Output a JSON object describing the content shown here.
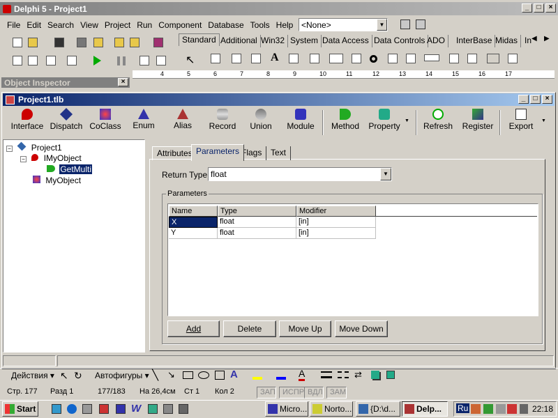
{
  "delphi": {
    "title": "Delphi 5 - Project1",
    "menu": [
      "File",
      "Edit",
      "Search",
      "View",
      "Project",
      "Run",
      "Component",
      "Database",
      "Tools",
      "Help"
    ],
    "config_combo": "<None>",
    "palette_tabs": [
      "Standard",
      "Additional",
      "Win32",
      "System",
      "Data Access",
      "Data Controls",
      "ADO",
      "InterBase",
      "Midas",
      "In"
    ],
    "ruler": [
      "4",
      "5",
      "6",
      "7",
      "8",
      "9",
      "10",
      "11",
      "12",
      "13",
      "14",
      "15",
      "16",
      "17"
    ]
  },
  "inspector": {
    "title": "Object Inspector"
  },
  "tlb": {
    "title": "Project1.tlb",
    "toolbar": [
      "Interface",
      "Dispatch",
      "CoClass",
      "Enum",
      "Alias",
      "Record",
      "Union",
      "Module",
      "Method",
      "Property",
      "Refresh",
      "Register",
      "Export"
    ],
    "tree": {
      "root": "Project1",
      "interface": "IMyObject",
      "method": "GetMulti",
      "coclass": "MyObject"
    },
    "tabs": [
      "Attributes",
      "Parameters",
      "Flags",
      "Text"
    ],
    "return_type_label": "Return Type:",
    "return_type": "float",
    "params_group": "Parameters",
    "columns": [
      "Name",
      "Type",
      "Modifier"
    ],
    "rows": [
      {
        "name": "X",
        "type": "float",
        "mod": "[in]"
      },
      {
        "name": "Y",
        "type": "float",
        "mod": "[in]"
      }
    ],
    "buttons": [
      "Add",
      "Delete",
      "Move Up",
      "Move Down"
    ]
  },
  "word": {
    "draw": "Действия",
    "autoshapes": "Автофигуры",
    "status": [
      "Стр. 177",
      "Разд 1",
      "177/183",
      "На 26,4см",
      "Ст 1",
      "Кол 2",
      "ЗАП",
      "ИСПР",
      "ВДЛ",
      "ЗАМ"
    ]
  },
  "taskbar": {
    "start": "Start",
    "tasks": [
      "Micro...",
      "Norto...",
      "{D:\\d...",
      "Delp..."
    ],
    "lang": "Ru",
    "clock": "22:18"
  }
}
